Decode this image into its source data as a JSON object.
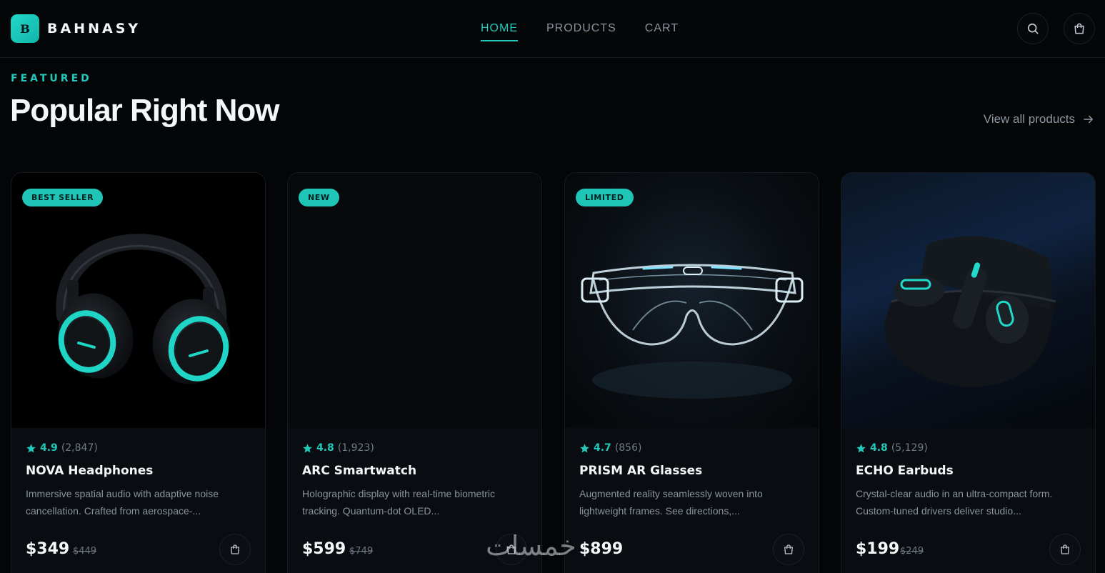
{
  "brand": {
    "logo_letter": "B",
    "name": "BAHNASY",
    "accent": "#22c9bb"
  },
  "nav": {
    "items": [
      {
        "label": "HOME",
        "active": true
      },
      {
        "label": "PRODUCTS",
        "active": false
      },
      {
        "label": "CART",
        "active": false
      }
    ]
  },
  "header_actions": {
    "search_icon": "search-icon",
    "cart_icon": "shopping-bag-icon"
  },
  "section": {
    "eyebrow": "FEATURED",
    "title": "Popular Right Now",
    "view_all": "View all products"
  },
  "products": [
    {
      "badge": "BEST SELLER",
      "rating": "4.9",
      "reviews": "(2,847)",
      "name": "NOVA Headphones",
      "description": "Immersive spatial audio with adaptive noise cancellation. Crafted from aerospace-...",
      "price": "$349",
      "old_price": "$449"
    },
    {
      "badge": "NEW",
      "rating": "4.8",
      "reviews": "(1,923)",
      "name": "ARC Smartwatch",
      "description": "Holographic display with real-time biometric tracking. Quantum-dot OLED...",
      "price": "$599",
      "old_price": "$749"
    },
    {
      "badge": "LIMITED",
      "rating": "4.7",
      "reviews": "(856)",
      "name": "PRISM AR Glasses",
      "description": "Augmented reality seamlessly woven into lightweight frames. See directions,...",
      "price": "$899",
      "old_price": ""
    },
    {
      "badge": "",
      "rating": "4.8",
      "reviews": "(5,129)",
      "name": "ECHO Earbuds",
      "description": "Crystal-clear audio in an ultra-compact form. Custom-tuned drivers deliver studio...",
      "price": "$199",
      "old_price": "$249"
    }
  ],
  "watermark": "خمسات"
}
